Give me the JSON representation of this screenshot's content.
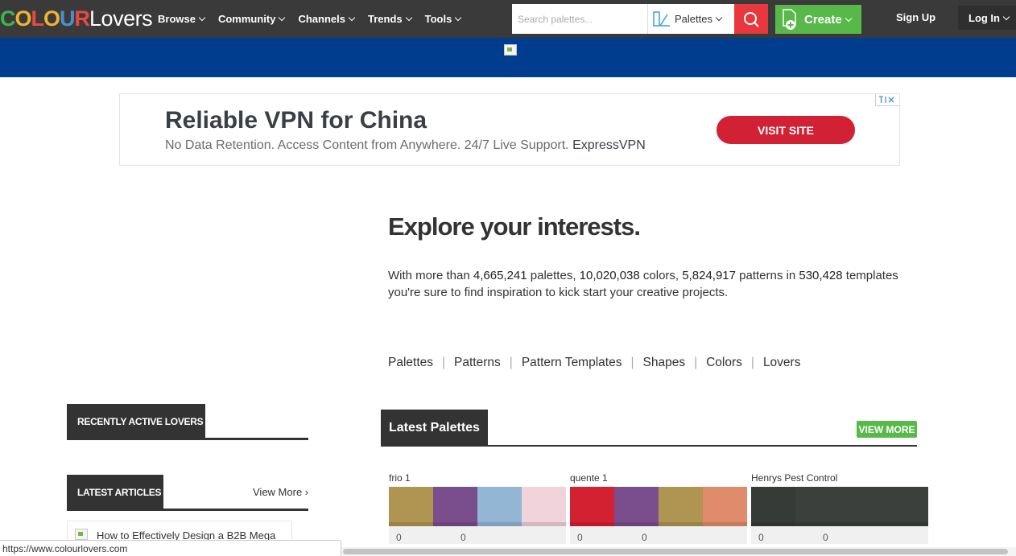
{
  "logo": {
    "part1": "COLOUR",
    "part2": "Lovers"
  },
  "nav": {
    "items": [
      "Browse",
      "Community",
      "Channels",
      "Trends",
      "Tools"
    ]
  },
  "search": {
    "placeholder": "Search palettes...",
    "type_label": "Palettes"
  },
  "create": {
    "label": "Create"
  },
  "auth": {
    "signup": "Sign Up",
    "login": "Log In"
  },
  "ad": {
    "title": "Reliable VPN for China",
    "subtitle": "No Data Retention. Access Content from Anywhere. 24/7 Live Support.",
    "brand": "ExpressVPN",
    "button": "VISIT SITE"
  },
  "explore": {
    "title": "Explore your interests.",
    "t1": "With more than ",
    "palettes": "4,665,241",
    "t2": " palettes, ",
    "colors": "10,020,038",
    "t3": " colors, ",
    "patterns": "5,824,917",
    "t4": " patterns in ",
    "templates": "530,428",
    "t5": " templates you're sure to find inspiration to kick start your creative projects."
  },
  "categories": [
    "Palettes",
    "Patterns",
    "Pattern Templates",
    "Shapes",
    "Colors",
    "Lovers"
  ],
  "sidebar": {
    "recent_lovers": "RECENTLY ACTIVE LOVERS",
    "latest_articles": "LATEST ARTICLES",
    "view_more": "View More ›",
    "article_title": "How to Effectively Design a B2B Mega"
  },
  "latest_palettes": {
    "title": "Latest Palettes",
    "view_more": "VIEW MORE",
    "items": [
      {
        "name": "frio 1",
        "colors": [
          "#af9452",
          "#7a4e8c",
          "#93b6d4",
          "#f0d3db"
        ],
        "views": "0",
        "loves": "0"
      },
      {
        "name": "quente 1",
        "colors": [
          "#d32132",
          "#7a4e8c",
          "#af9452",
          "#e08c6c"
        ],
        "views": "0",
        "loves": "0"
      },
      {
        "name": "Henrys Pest Control",
        "colors": [
          "#373b37",
          "#3c403c",
          "#3c403c",
          "#3c403c"
        ],
        "views": "0",
        "loves": "0"
      }
    ]
  },
  "status_url": "https://www.colourlovers.com"
}
